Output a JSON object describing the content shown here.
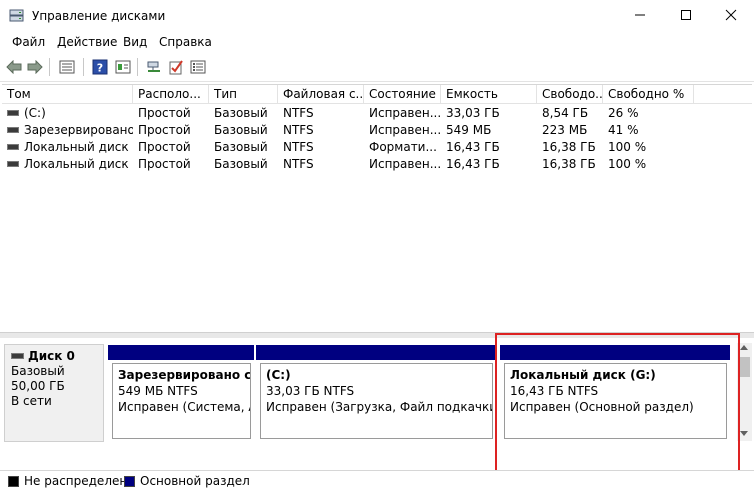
{
  "window": {
    "title": "Управление дисками"
  },
  "menu": [
    "Файл",
    "Действие",
    "Вид",
    "Справка"
  ],
  "toolbar": {
    "icons": [
      "back-arrow-icon",
      "forward-arrow-icon",
      "list-view-icon",
      "help-icon",
      "properties-icon",
      "connect-icon",
      "check-icon",
      "settings-list-icon"
    ]
  },
  "volumes": {
    "columns": [
      "Том",
      "Располо...",
      "Тип",
      "Файловая с...",
      "Состояние",
      "Емкость",
      "Свободо...",
      "Свободно %"
    ],
    "rows": [
      [
        "(C:)",
        "Простой",
        "Базовый",
        "NTFS",
        "Исправен...",
        "33,03 ГБ",
        "8,54 ГБ",
        "26 %"
      ],
      [
        "Зарезервировано...",
        "Простой",
        "Базовый",
        "NTFS",
        "Исправен...",
        "549 МБ",
        "223 МБ",
        "41 %"
      ],
      [
        "Локальный диск",
        "Простой",
        "Базовый",
        "NTFS",
        "Формати...",
        "16,43 ГБ",
        "16,38 ГБ",
        "100 %"
      ],
      [
        "Локальный диск (...",
        "Простой",
        "Базовый",
        "NTFS",
        "Исправен...",
        "16,43 ГБ",
        "16,38 ГБ",
        "100 %"
      ]
    ]
  },
  "disk0": {
    "name": "Диск 0",
    "type": "Базовый",
    "size": "50,00 ГБ",
    "status": "В сети",
    "partitions": [
      {
        "name": "Зарезервировано сист",
        "size": "549 МБ NTFS",
        "status": "Исправен (Система, Акт"
      },
      {
        "name": "(C:)",
        "size": "33,03 ГБ NTFS",
        "status": "Исправен (Загрузка, Файл подкачки, Авар"
      },
      {
        "name": "Локальный диск  (G:)",
        "size": "16,43 ГБ NTFS",
        "status": "Исправен (Основной раздел)"
      }
    ]
  },
  "legend": {
    "items": [
      {
        "label": "Не распределена",
        "color": "#000000"
      },
      {
        "label": "Основной раздел",
        "color": "#000080"
      }
    ]
  },
  "colors": {
    "partition_stripe": "#000080",
    "highlight": "#dd2222"
  }
}
